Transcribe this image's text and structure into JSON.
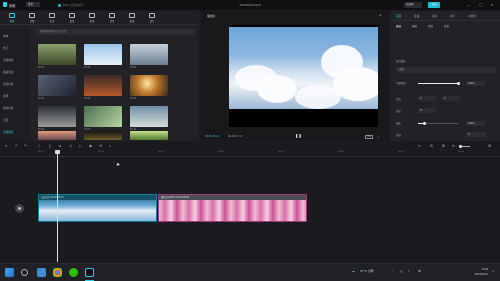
{
  "app": {
    "title": "剪映",
    "menu_label": "菜单",
    "project_name": "0821 项目未保存",
    "window_title": "202108211020"
  },
  "header": {
    "shortcut_label": "快捷键",
    "export_label": "导出",
    "minimize": "—",
    "maximize": "□",
    "close": "×"
  },
  "media_tabs": [
    {
      "label": "媒体",
      "icon": "media-icon"
    },
    {
      "label": "音频",
      "icon": "audio-icon"
    },
    {
      "label": "文本",
      "icon": "text-icon"
    },
    {
      "label": "贴纸",
      "icon": "sticker-icon"
    },
    {
      "label": "特效",
      "icon": "effect-icon"
    },
    {
      "label": "转场",
      "icon": "transition-icon"
    },
    {
      "label": "滤镜",
      "icon": "filter-icon"
    },
    {
      "label": "调节",
      "icon": "adjust-icon"
    }
  ],
  "side_nav": [
    "本地",
    "热门",
    "空镜素材",
    "情绪氛围",
    "氛围片段",
    "转场",
    "搞笑片段",
    "空镜",
    "空镜素材"
  ],
  "search": {
    "placeholder": "搜索视频素材(中文)/文案"
  },
  "thumbnails": [
    {
      "label": "00:03"
    },
    {
      "label": "00:08"
    },
    {
      "label": "00:05"
    },
    {
      "label": "00:11"
    },
    {
      "label": "00:06"
    },
    {
      "label": "00:04"
    },
    {
      "label": "00:09"
    },
    {
      "label": "00:07"
    },
    {
      "label": "00:10"
    },
    {
      "label": "00:05"
    },
    {
      "label": "00:03"
    },
    {
      "label": "00:08"
    }
  ],
  "player": {
    "title": "播放器",
    "time_current": "00:00:01:21",
    "time_total": "00:00:17:17",
    "ratio_label": "原始",
    "play_icon": "❚❚",
    "fullscreen_icon": "⤢"
  },
  "inspector": {
    "tabs": [
      "画面",
      "变速",
      "动画",
      "调节",
      "AI效果"
    ],
    "subtabs": [
      "基础",
      "抠图",
      "蒙版",
      "背景"
    ],
    "blend_label": "混合模式",
    "blend_value": "正常",
    "opacity_label": "不透明度",
    "opacity_value": "100%",
    "opacity_level": 1.0,
    "position_label": "位置",
    "position_x": "0",
    "position_y": "0",
    "rotate_label": "旋转",
    "rotate_value": "0°",
    "scale_label": "缩放",
    "scale_value": "100%",
    "scale_level": 0.15,
    "extra_label": "美颜",
    "extra_value": "0"
  },
  "timeline": {
    "ruler": [
      "00:00",
      "00:05",
      "00:10",
      "00:15",
      "00:20",
      "00:25",
      "00:30",
      "00:35"
    ],
    "clip1": {
      "label": "云朵天空 00:00:05:13"
    },
    "clip2": {
      "label": "樱花花开MOV 00:00:08:06"
    }
  },
  "taskbar": {
    "weather": "27°C 大雨",
    "lang": "中",
    "time": "8:16",
    "date": "2021/8/11"
  },
  "colors": {
    "accent": "#28d0e0",
    "clip1": "#1a5a78",
    "clip2": "#c84f9a"
  }
}
